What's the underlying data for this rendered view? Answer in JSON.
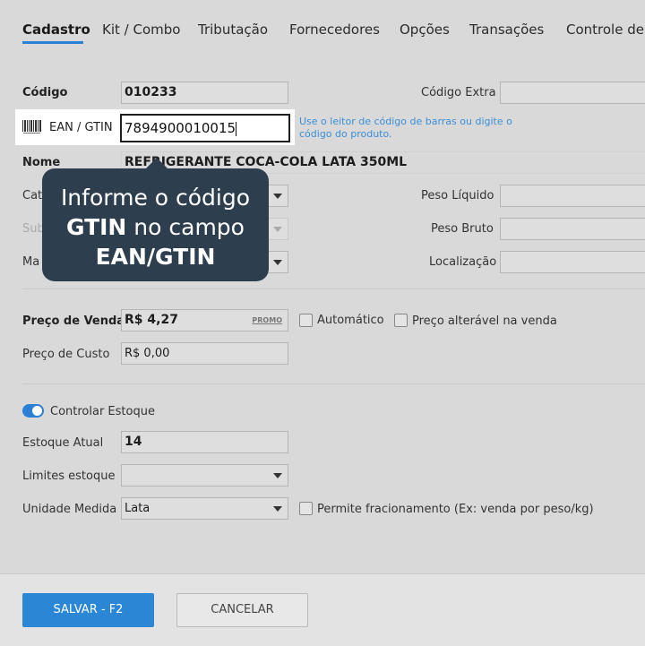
{
  "tabs": [
    "Cadastro",
    "Kit / Combo",
    "Tributação",
    "Fornecedores",
    "Opções",
    "Transações",
    "Controle de"
  ],
  "form": {
    "codigo_label": "Código",
    "codigo_value": "010233",
    "codigo_extra_label": "Código Extra",
    "codigo_extra_value": "",
    "ean_label": "EAN / GTIN",
    "ean_value": "7894900010015",
    "ean_hint": "Use o leitor de código de barras ou digite o código do produto.",
    "nome_label": "Nome",
    "nome_value": "REFRIGERANTE COCA-COLA LATA 350ML",
    "categoria_label": "Cat",
    "subcategoria_label": "Sub",
    "marca_label": "Ma",
    "peso_liquido_label": "Peso Líquido",
    "peso_bruto_label": "Peso Bruto",
    "localizacao_label": "Localização",
    "preco_venda_label": "Preço de Venda",
    "preco_venda_value": "R$ 4,27",
    "promo_label": "PROMO",
    "automatico_label": "Automático",
    "preco_alteravel_label": "Preço alterável na venda",
    "preco_custo_label": "Preço de Custo",
    "preco_custo_value": "R$ 0,00",
    "controlar_estoque_label": "Controlar Estoque",
    "controlar_estoque_on": true,
    "estoque_atual_label": "Estoque Atual",
    "estoque_atual_value": "14",
    "limites_estoque_label": "Limites estoque",
    "limites_estoque_value": "",
    "unidade_medida_label": "Unidade Medida",
    "unidade_medida_value": "Lata",
    "fracionamento_label": "Permite fracionamento (Ex: venda por peso/kg)"
  },
  "tooltip": {
    "line1": "Informe o código",
    "line2_bold": "GTIN",
    "line2_rest": " no campo",
    "line3_bold": "EAN/GTIN"
  },
  "footer": {
    "save_label": "SALVAR - F2",
    "cancel_label": "CANCELAR"
  },
  "colors": {
    "accent": "#2b87d6",
    "tooltip_bg": "#2d3e4f",
    "hint": "#3a8fd8"
  }
}
